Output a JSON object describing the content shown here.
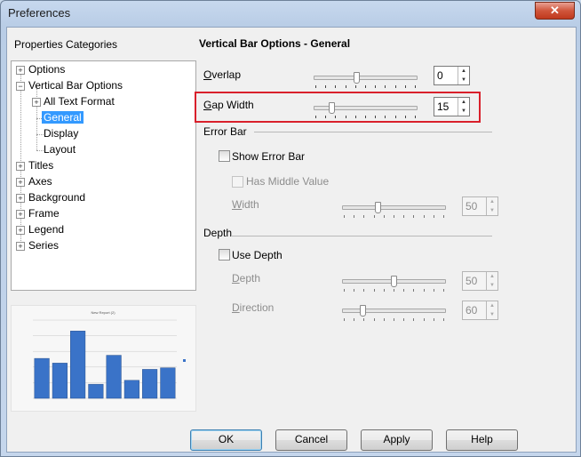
{
  "window": {
    "title": "Preferences",
    "close_glyph": "✕"
  },
  "sidebar": {
    "heading": "Properties Categories",
    "tree": [
      {
        "label": "Options",
        "expander": "+"
      },
      {
        "label": "Vertical Bar Options",
        "expander": "−"
      },
      {
        "label": "All Text Format",
        "expander": "+"
      },
      {
        "label": "General",
        "selected": true
      },
      {
        "label": "Display"
      },
      {
        "label": "Layout"
      },
      {
        "label": "Titles",
        "expander": "+"
      },
      {
        "label": "Axes",
        "expander": "+"
      },
      {
        "label": "Background",
        "expander": "+"
      },
      {
        "label": "Frame",
        "expander": "+"
      },
      {
        "label": "Legend",
        "expander": "+"
      },
      {
        "label": "Series",
        "expander": "+"
      }
    ]
  },
  "preview": {
    "title": "New Report (2)",
    "type": "bar",
    "values": [
      5.1,
      4.5,
      8.6,
      1.8,
      5.5,
      2.3,
      3.7,
      3.9
    ],
    "ymax": 10,
    "bar_color": "#3a73c8"
  },
  "panel": {
    "heading": "Vertical Bar Options - General",
    "overlap": {
      "label": "Overlap",
      "value": "0",
      "slider_pct": 0.41
    },
    "gap_width": {
      "label": "Gap Width",
      "value": "15",
      "slider_pct": 0.15
    },
    "error_bar": {
      "section": "Error Bar",
      "show_label": "Show Error Bar",
      "middle_label": "Has Middle Value",
      "width_label": "Width",
      "width_value": "50",
      "width_slider_pct": 0.34
    },
    "depth": {
      "section": "Depth",
      "use_label": "Use Depth",
      "depth_label": "Depth",
      "depth_value": "50",
      "depth_slider_pct": 0.5,
      "direction_label": "Direction",
      "direction_value": "60",
      "direction_slider_pct": 0.18
    }
  },
  "buttons": {
    "ok": "OK",
    "cancel": "Cancel",
    "apply": "Apply",
    "help": "Help"
  },
  "colors": {
    "highlight": "#d9202b",
    "selection": "#3399ff"
  }
}
